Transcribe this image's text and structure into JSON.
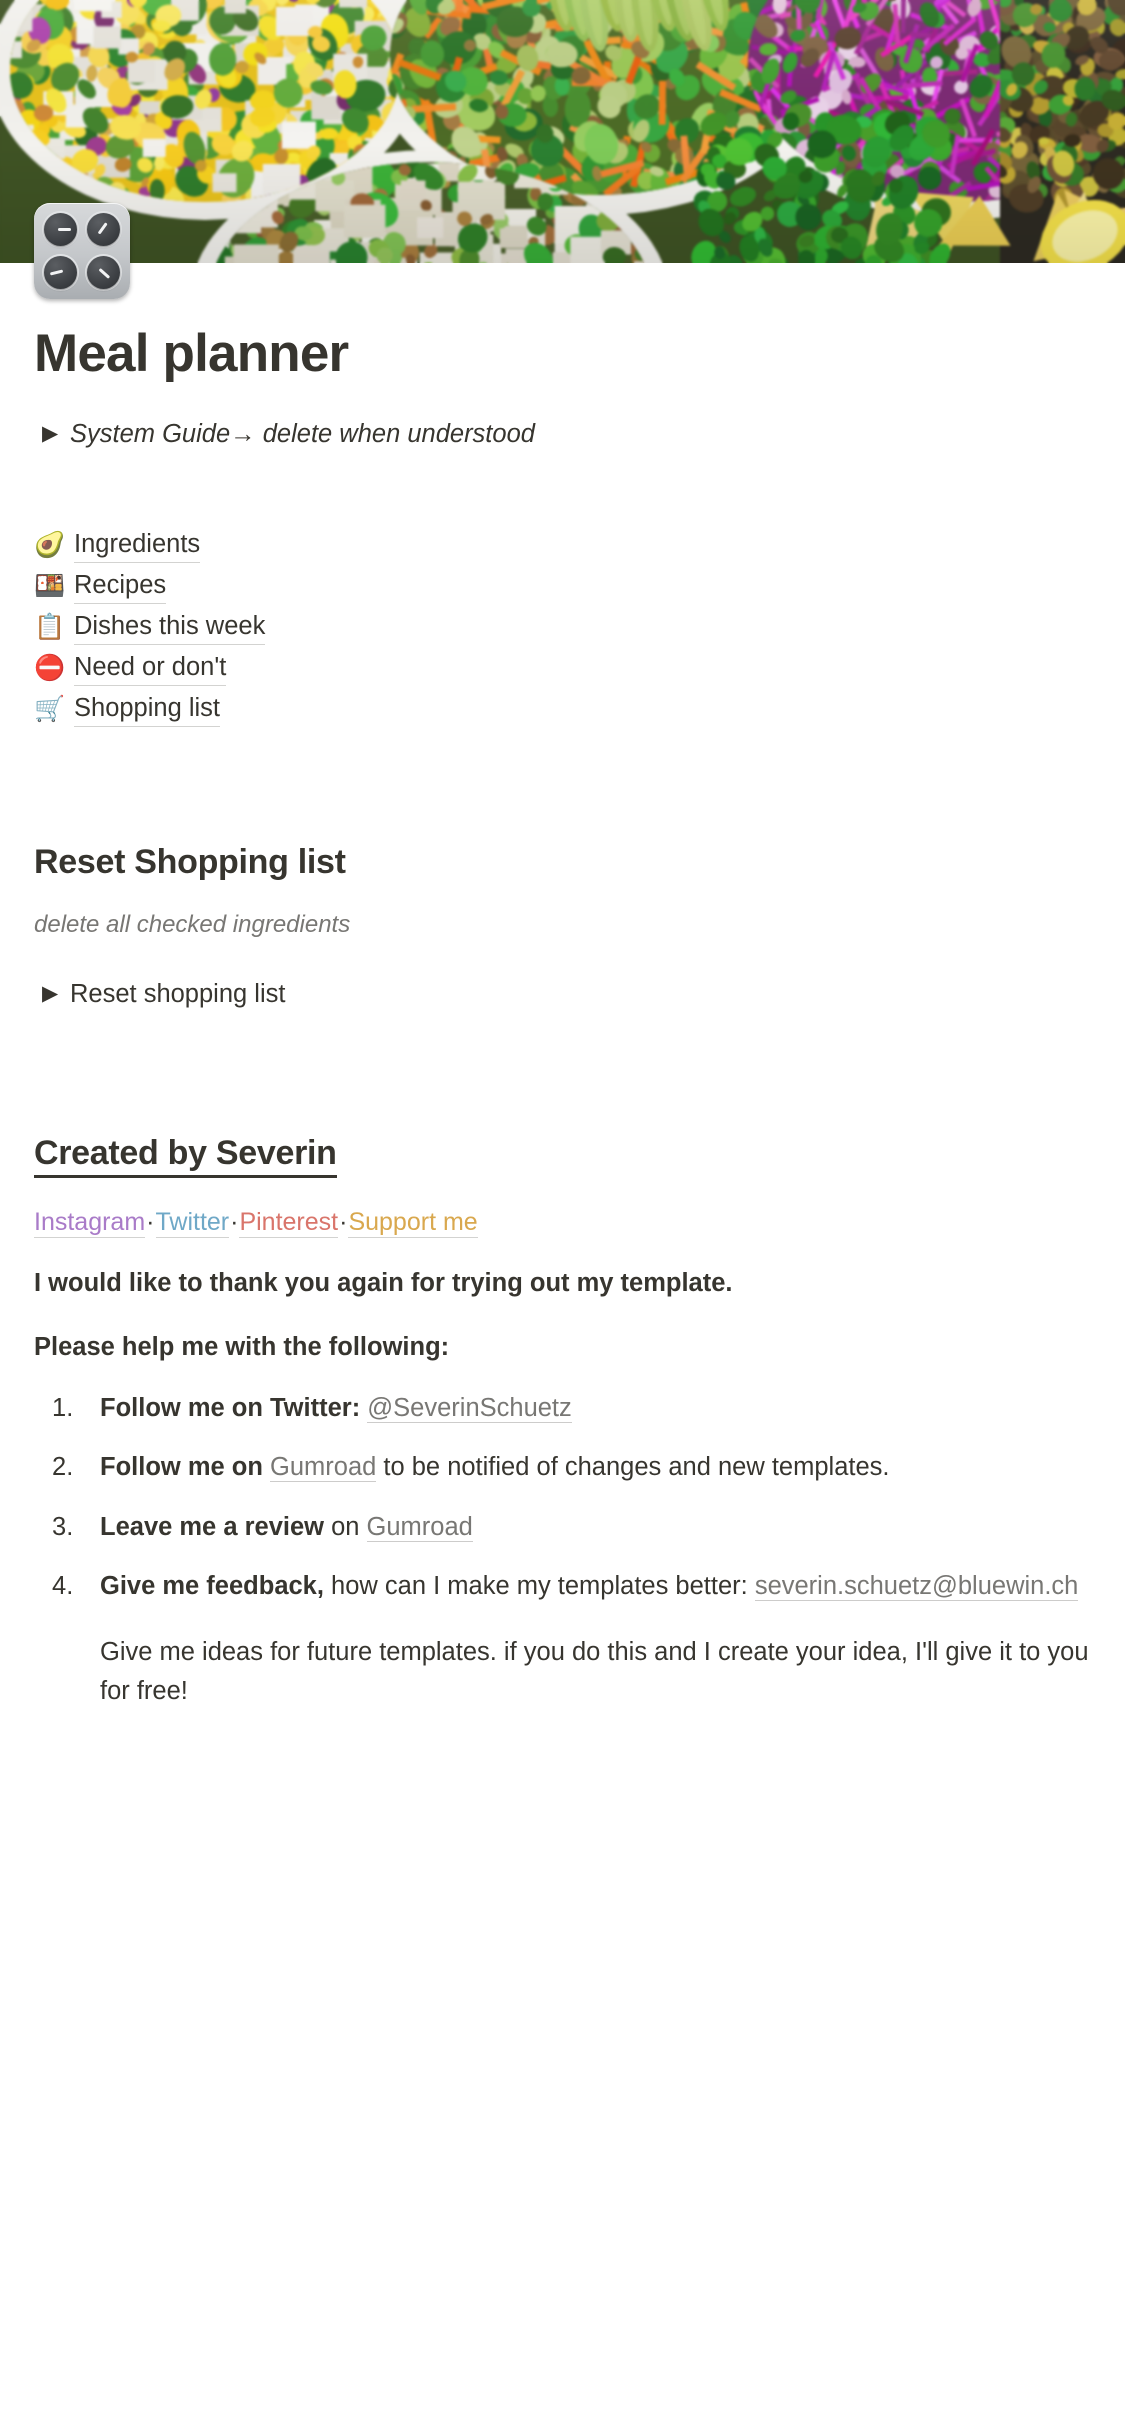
{
  "page": {
    "title": "Meal planner",
    "icon": "control-knobs-emoji",
    "cover_alt": "salad bowls with tofu, corn, carrots, red cabbage and greens"
  },
  "system_guide_toggle": {
    "arrow": "▶",
    "label": "System Guide→ delete when understood"
  },
  "links": [
    {
      "emoji": "🥑",
      "icon_name": "avocado-emoji",
      "label": "Ingredients"
    },
    {
      "emoji": "🍱",
      "icon_name": "bento-box-emoji",
      "label": "Recipes"
    },
    {
      "emoji": "📋",
      "icon_name": "clipboard-emoji",
      "label": "Dishes this week"
    },
    {
      "emoji": "⛔",
      "icon_name": "no-entry-emoji",
      "label": "Need or don't"
    },
    {
      "emoji": "🛒",
      "icon_name": "shopping-cart-emoji",
      "label": "Shopping list"
    }
  ],
  "reset_section": {
    "heading": "Reset Shopping list",
    "subtitle": "delete all checked ingredients",
    "toggle_arrow": "▶",
    "toggle_label": "Reset shopping list"
  },
  "created_by": {
    "heading": "Created by Severin",
    "social": [
      {
        "label": "Instagram",
        "color": "#A97BC8"
      },
      {
        "label": "Twitter",
        "color": "#6FA8C7"
      },
      {
        "label": "Pinterest",
        "color": "#D9756B"
      },
      {
        "label": "Support me",
        "color": "#D9A84E"
      }
    ],
    "separator": "·",
    "thanks": "I would like to thank you again for trying out my template.",
    "help_heading": "Please help me with the following:",
    "tasks": [
      {
        "pre_bold": "Follow me on Twitter:",
        "link": "@SeverinSchuetz",
        "post": ""
      },
      {
        "pre_bold": "Follow me on",
        "link": "Gumroad",
        "post": " to be notified of changes and new templates."
      },
      {
        "pre_bold": "Leave me a review",
        "mid": " on ",
        "link": "Gumroad",
        "post": ""
      },
      {
        "pre_bold": "Give me feedback,",
        "mid": " how can I make my templates better:",
        "link": "severin.schuetz@bluewin.ch",
        "post": ""
      }
    ],
    "closing_note": "Give me ideas for future templates. if you do this and I create your idea, I'll give it to you for free!"
  },
  "colors": {
    "text": "#37352F",
    "muted": "#787774",
    "link_underline": "rgba(55,53,47,.22)"
  }
}
